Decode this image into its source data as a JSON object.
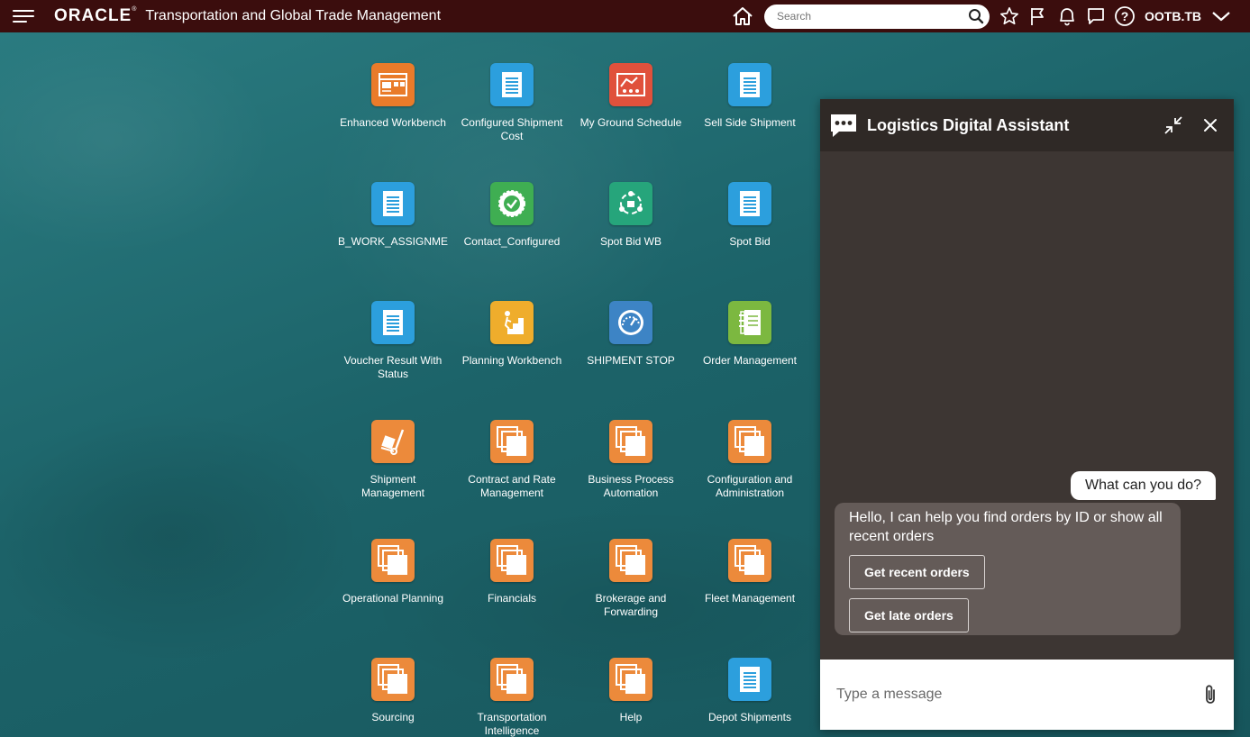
{
  "header": {
    "logo": "ORACLE",
    "logo_mark": "®",
    "app_title": "Transportation and Global Trade Management",
    "search_placeholder": "Search",
    "user": "OOTB.TB"
  },
  "tiles": [
    {
      "label": "Enhanced Workbench",
      "icon": "workbench-icon",
      "color": "#e97b2a"
    },
    {
      "label": "Configured Shipment Cost",
      "icon": "document-icon",
      "color": "#2c9fdd"
    },
    {
      "label": "My Ground Schedule",
      "icon": "schedule-icon",
      "color": "#e0513c"
    },
    {
      "label": "Sell Side Shipment",
      "icon": "document-icon",
      "color": "#2c9fdd"
    },
    {
      "label": "TB_WORK_ASSIGNME",
      "icon": "document-icon",
      "color": "#2c9fdd"
    },
    {
      "label": "Contact_Configured",
      "icon": "badge-check-icon",
      "color": "#3fae52"
    },
    {
      "label": "Spot Bid WB",
      "icon": "bid-cycle-icon",
      "color": "#26a57b"
    },
    {
      "label": "Spot Bid",
      "icon": "document-icon",
      "color": "#2c9fdd"
    },
    {
      "label": "Voucher Result With Status",
      "icon": "document-icon",
      "color": "#2c9fdd"
    },
    {
      "label": "Planning Workbench",
      "icon": "stairs-climber-icon",
      "color": "#efad2c"
    },
    {
      "label": "SHIPMENT STOP",
      "icon": "gauge-icon",
      "color": "#3d84c5"
    },
    {
      "label": "Order Management",
      "icon": "notebook-icon",
      "color": "#7cb840"
    },
    {
      "label": "Shipment Management",
      "icon": "hand-truck-icon",
      "color": "#ec8a3b"
    },
    {
      "label": "Contract and Rate Management",
      "icon": "stacked-pages-icon",
      "color": "#ec8a3b"
    },
    {
      "label": "Business Process Automation",
      "icon": "stacked-pages-icon",
      "color": "#ec8a3b"
    },
    {
      "label": "Configuration and Administration",
      "icon": "stacked-pages-icon",
      "color": "#ec8a3b"
    },
    {
      "label": "Operational Planning",
      "icon": "stacked-pages-icon",
      "color": "#ec8a3b"
    },
    {
      "label": "Financials",
      "icon": "stacked-pages-icon",
      "color": "#ec8a3b"
    },
    {
      "label": "Brokerage and Forwarding",
      "icon": "stacked-pages-icon",
      "color": "#ec8a3b"
    },
    {
      "label": "Fleet Management",
      "icon": "stacked-pages-icon",
      "color": "#ec8a3b"
    },
    {
      "label": "Sourcing",
      "icon": "stacked-pages-icon",
      "color": "#ec8a3b"
    },
    {
      "label": "Transportation Intelligence",
      "icon": "stacked-pages-icon",
      "color": "#ec8a3b"
    },
    {
      "label": "Help",
      "icon": "stacked-pages-icon",
      "color": "#ec8a3b"
    },
    {
      "label": "Depot Shipments",
      "icon": "document-icon",
      "color": "#2c9fdd"
    }
  ],
  "assistant": {
    "title": "Logistics Digital Assistant",
    "user_message": "What can you do?",
    "bot_message": "Hello, I can help you find orders by ID or show all recent orders",
    "actions": [
      "Get recent orders",
      "Get late orders"
    ],
    "input_placeholder": "Type a message"
  }
}
